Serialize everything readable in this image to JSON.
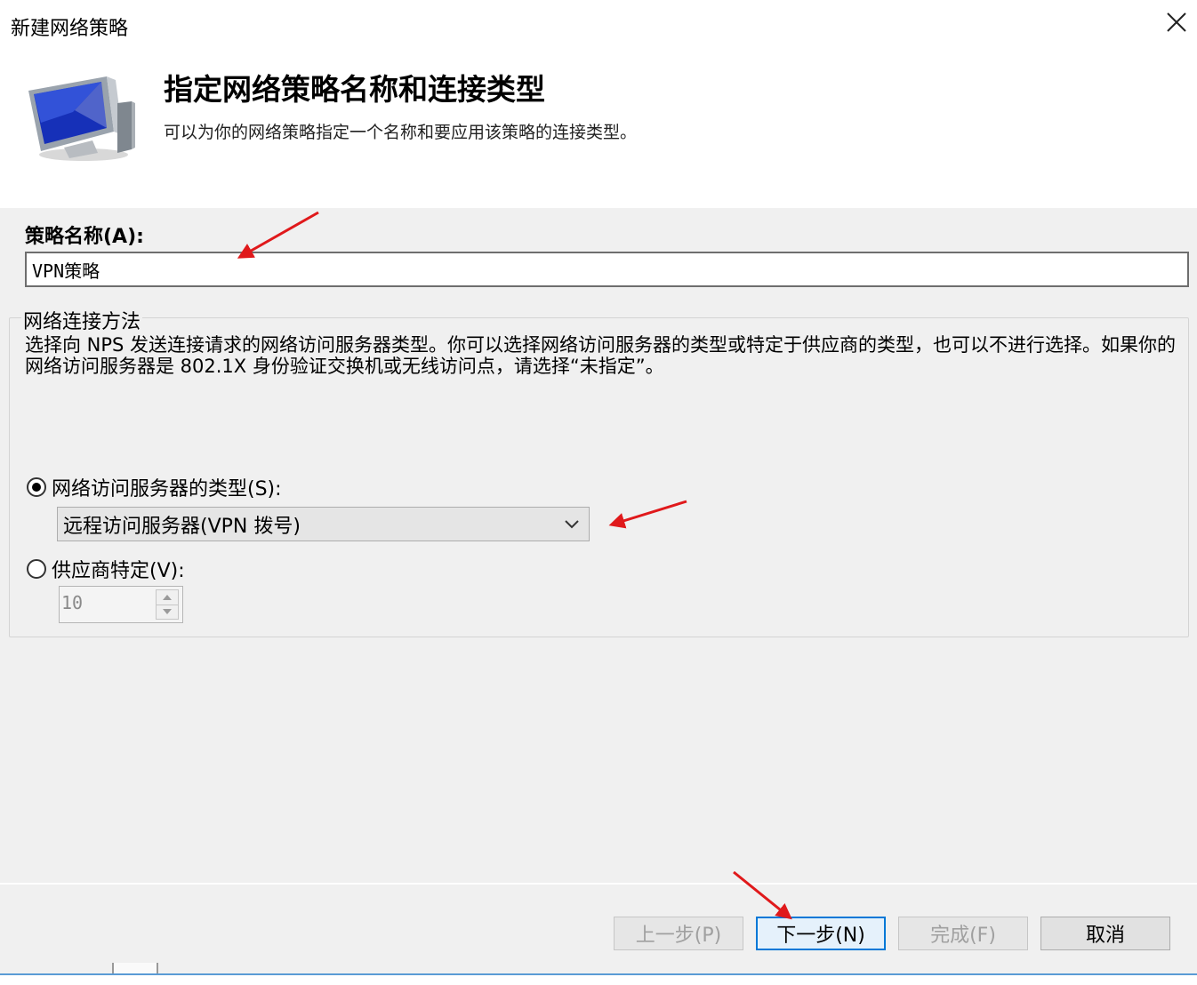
{
  "window": {
    "title": "新建网络策略",
    "close_icon": "close-icon"
  },
  "header": {
    "icon": "computer-monitor-icon",
    "title": "指定网络策略名称和连接类型",
    "description": "可以为你的网络策略指定一个名称和要应用该策略的连接类型。"
  },
  "policy_name": {
    "label": "策略名称(A):",
    "value": "VPN策略"
  },
  "connection_method": {
    "legend": "网络连接方法",
    "description": "选择向 NPS 发送连接请求的网络访问服务器类型。你可以选择网络访问服务器的类型或特定于供应商的类型，也可以不进行选择。如果你的网络访问服务器是 802.1X 身份验证交换机或无线访问点，请选择“未指定”。",
    "nas_type_label": "网络访问服务器的类型(S):",
    "nas_type_selected": true,
    "nas_type_value": "远程访问服务器(VPN 拨号)",
    "vendor_label": "供应商特定(V):",
    "vendor_selected": false,
    "vendor_value": "10"
  },
  "buttons": {
    "back": "上一步(P)",
    "next": "下一步(N)",
    "finish": "完成(F)",
    "cancel": "取消"
  },
  "annotation_color": "#e0191b"
}
